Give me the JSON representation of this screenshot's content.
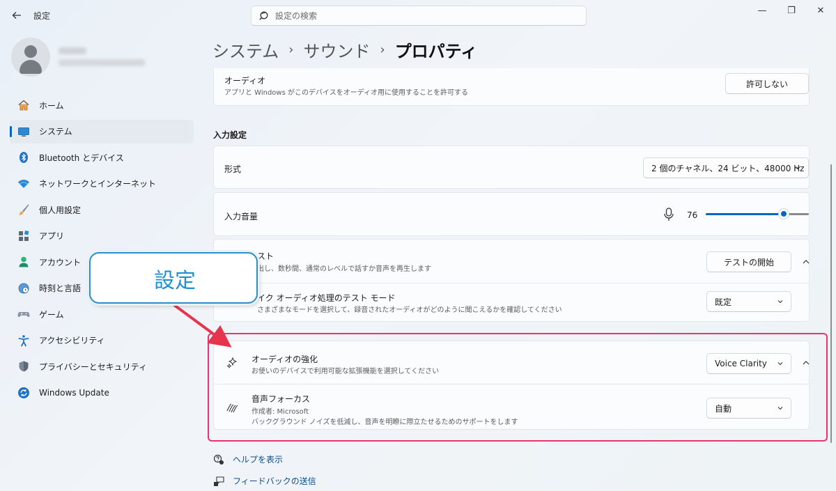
{
  "window": {
    "title": "設定",
    "search_placeholder": "設定の検索",
    "minimize_glyph": "—",
    "maximize_glyph": "❐",
    "close_glyph": "✕"
  },
  "sidebar": {
    "items": [
      {
        "label": "ホーム",
        "icon": "home-icon"
      },
      {
        "label": "システム",
        "icon": "system-icon",
        "active": true
      },
      {
        "label": "Bluetooth とデバイス",
        "icon": "bluetooth-icon"
      },
      {
        "label": "ネットワークとインターネット",
        "icon": "wifi-icon"
      },
      {
        "label": "個人用設定",
        "icon": "brush-icon"
      },
      {
        "label": "アプリ",
        "icon": "apps-icon"
      },
      {
        "label": "アカウント",
        "icon": "account-icon"
      },
      {
        "label": "時刻と言語",
        "icon": "clock-globe-icon"
      },
      {
        "label": "ゲーム",
        "icon": "gamepad-icon"
      },
      {
        "label": "アクセシビリティ",
        "icon": "accessibility-icon"
      },
      {
        "label": "プライバシーとセキュリティ",
        "icon": "shield-icon"
      },
      {
        "label": "Windows Update",
        "icon": "update-icon"
      }
    ]
  },
  "breadcrumb": {
    "level1": "システム",
    "level2": "サウンド",
    "current": "プロパティ",
    "separator": "›"
  },
  "audio_card": {
    "title": "オーディオ",
    "description": "アプリと Windows がこのデバイスをオーディオ用に使用することを許可する",
    "button": "許可しない"
  },
  "input_section": {
    "label": "入力設定",
    "format": {
      "title": "形式",
      "value": "2 個のチャネル、24 ビット、48000 Hz"
    },
    "volume": {
      "title": "入力音量",
      "value": "76",
      "level_percent": 76
    },
    "test": {
      "title": "スト",
      "description": "出し、数秒間、通常のレベルで話すか音声を再生します",
      "button": "テストの開始"
    },
    "mic_test_mode": {
      "title": "イク オーディオ処理のテスト モード",
      "description": "さまざまなモードを選択して、録音されたオーディオがどのように聞こえるかを確認してください",
      "value": "既定"
    },
    "enhancement": {
      "title": "オーディオの強化",
      "description": "お使いのデバイスで利用可能な拡張機能を選択してください",
      "value": "Voice Clarity"
    },
    "voice_focus": {
      "title": "音声フォーカス",
      "author": "作成者: Microsoft",
      "description": "バックグラウンド ノイズを低減し、音声を明瞭に際立たせるためのサポートをします",
      "value": "自動"
    }
  },
  "annotation": {
    "callout_text": "設定",
    "highlight_color": "#e8336d",
    "callout_border_color": "#2c8ec4"
  },
  "footer_links": {
    "help": "ヘルプを表示",
    "feedback": "フィードバックの送信"
  },
  "colors": {
    "accent": "#0067c0"
  }
}
